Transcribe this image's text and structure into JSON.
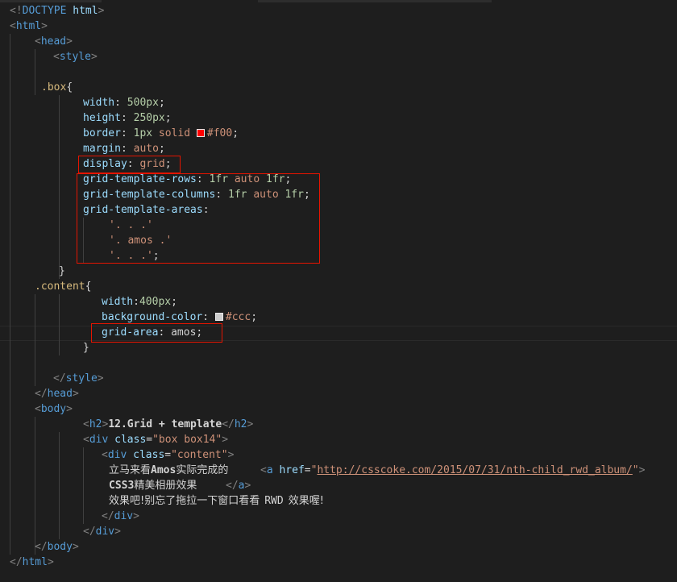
{
  "editor": {
    "colors": {
      "background": "#1e1e1e",
      "highlight_box": "#e51400",
      "red_swatch": "#ff0000",
      "gray_swatch": "#cccccc"
    },
    "lines": {
      "l1": {
        "a": "<!",
        "b": "DOCTYPE",
        "c": " html",
        "d": ">"
      },
      "l2": {
        "a": "<",
        "b": "html",
        "c": ">"
      },
      "l3": {
        "a": "<",
        "b": "head",
        "c": ">"
      },
      "l4": {
        "a": "<",
        "b": "style",
        "c": ">"
      },
      "l6": {
        "a": ".box",
        "b": "{"
      },
      "l7": {
        "prop": "width",
        "colon": ": ",
        "val": "500px",
        "semi": ";"
      },
      "l8": {
        "prop": "height",
        "colon": ": ",
        "val": "250px",
        "semi": ";"
      },
      "l9": {
        "prop": "border",
        "colon": ": ",
        "v1": "1px",
        "v2": " solid ",
        "v3": "#f00",
        "semi": ";"
      },
      "l10": {
        "prop": "margin",
        "colon": ": ",
        "val": "auto",
        "semi": ";"
      },
      "l11": {
        "prop": "display",
        "colon": ": ",
        "val": "grid",
        "semi": ";"
      },
      "l12": {
        "prop": "grid-template-rows",
        "colon": ": ",
        "v1": "1fr",
        "v2": " auto ",
        "v3": "1fr",
        "semi": ";"
      },
      "l13": {
        "prop": "grid-template-columns",
        "colon": ": ",
        "v1": "1fr",
        "v2": " auto ",
        "v3": "1fr",
        "semi": ";"
      },
      "l14": {
        "prop": "grid-template-areas",
        "colon": ":"
      },
      "l15": {
        "str": "'. . .'"
      },
      "l16": {
        "str": "'. amos .'"
      },
      "l17": {
        "str": "'. . .'",
        "semi": ";"
      },
      "l18": {
        "brace": "}"
      },
      "l19": {
        "a": ".content",
        "b": "{"
      },
      "l20": {
        "prop": "width",
        "colon": ":",
        "val": "400px",
        "semi": ";"
      },
      "l21": {
        "prop": "background-color",
        "colon": ": ",
        "val": "#ccc",
        "semi": ";"
      },
      "l22": {
        "prop": "grid-area",
        "colon": ": ",
        "val": "amos",
        "semi": ";"
      },
      "l23": {
        "brace": "}"
      },
      "l25": {
        "a": "</",
        "b": "style",
        "c": ">"
      },
      "l26": {
        "a": "</",
        "b": "head",
        "c": ">"
      },
      "l27": {
        "a": "<",
        "b": "body",
        "c": ">"
      },
      "l28": {
        "a": "<",
        "b": "h2",
        "c": ">",
        "text": "12.Grid + template",
        "d": "</",
        "e": "h2",
        "f": ">"
      },
      "l29": {
        "a": "<",
        "b": "div",
        "attr": " class",
        "eq": "=",
        "val": "\"box box14\"",
        "c": ">"
      },
      "l30": {
        "a": "<",
        "b": "div",
        "attr": " class",
        "eq": "=",
        "val": "\"content\"",
        "c": ">"
      },
      "l31": {
        "cjk1": "立马来看",
        "bold": "Amos",
        "cjk2": "实际完成的",
        "a": "<",
        "b": "a",
        "attr": " href",
        "eq": "=",
        "q1": "\"",
        "url": "http://csscoke.com/2015/07/31/nth-child_rwd_album/",
        "q2": "\"",
        "c": ">"
      },
      "l32": {
        "bold": "CSS3",
        "cjk": "精美相册效果",
        "a": "</",
        "b": "a",
        "c": ">"
      },
      "l33": {
        "cjk1": "效果吧!别忘了拖拉一下窗口看看",
        "bold": "RWD",
        "cjk2": "效果喔!"
      },
      "l34": {
        "a": "</",
        "b": "div",
        "c": ">"
      },
      "l35": {
        "a": "</",
        "b": "div",
        "c": ">"
      },
      "l36": {
        "a": "</",
        "b": "body",
        "c": ">"
      },
      "l37": {
        "a": "</",
        "b": "html",
        "c": ">"
      }
    }
  }
}
